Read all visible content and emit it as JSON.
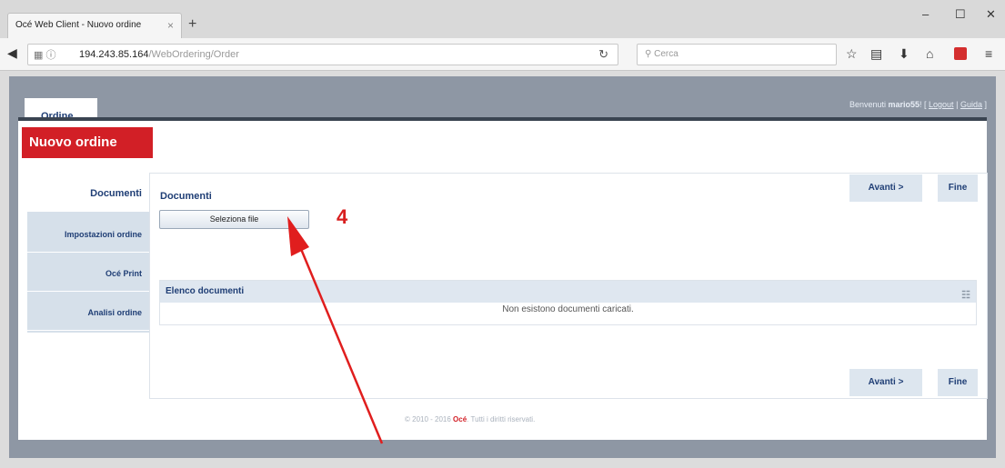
{
  "browser": {
    "tab_title": "Océ Web Client - Nuovo ordine",
    "tab_close": "×",
    "new_tab": "+",
    "url_host": "194.243.85.164",
    "url_path": "/WebOrdering/Order",
    "search_placeholder": "Cerca",
    "icons": [
      "back-arrow-icon",
      "lock-icon",
      "info-icon",
      "reload-icon",
      "search-icon",
      "star-icon",
      "clipboard-icon",
      "download-icon",
      "home-icon",
      "pdf-icon",
      "menu-icon"
    ]
  },
  "app": {
    "tab_label": "Ordine",
    "welcome_prefix": "Benvenuti ",
    "username": "mario55",
    "welcome_suffix": "! [",
    "logout_label": "Logout",
    "separator": "|",
    "help_label": "Guida",
    "close_bracket": "]",
    "page_title": "Nuovo ordine"
  },
  "sidebar": {
    "items": [
      {
        "label": "Documenti"
      },
      {
        "label": "Impostazioni ordine"
      },
      {
        "label": "Océ Print"
      },
      {
        "label": "Analisi ordine"
      }
    ]
  },
  "main": {
    "heading": "Documenti",
    "select_button": "Seleziona file",
    "annotation": "4",
    "next_label": "Avanti >",
    "finish_label": "Fine",
    "list_header": "Elenco documenti",
    "empty_message": "Non esistono documenti caricati."
  },
  "footer": {
    "prefix": "© 2010 - 2016 ",
    "brand": "Océ",
    "suffix": ". Tutti i diritti riservati."
  },
  "colors": {
    "accent_red": "#d21f26",
    "navy": "#1f3e75",
    "annotation_red": "#d81f1f"
  }
}
